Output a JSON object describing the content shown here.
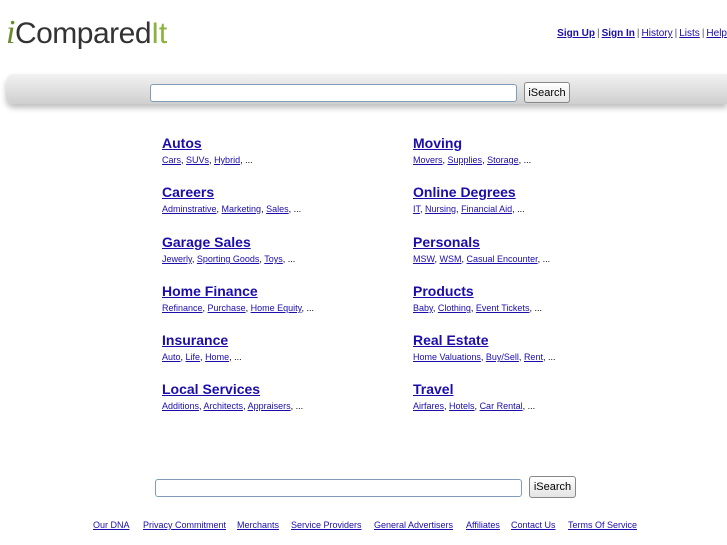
{
  "logo": {
    "i": "i",
    "compared": "Compared",
    "it": "It"
  },
  "toplinks": {
    "sign_up": "Sign Up",
    "sign_in": "Sign In",
    "history": "History",
    "lists": "Lists",
    "help": "Help",
    "sep": "|"
  },
  "search": {
    "value": "",
    "button_label": "iSearch"
  },
  "categories": [
    {
      "title": "Autos",
      "subs": [
        "Cars",
        "SUVs",
        "Hybrid"
      ]
    },
    {
      "title": "Careers",
      "subs": [
        "Adminstrative",
        "Marketing",
        "Sales"
      ]
    },
    {
      "title": "Garage Sales",
      "subs": [
        "Jewerly",
        "Sporting Goods",
        "Toys"
      ]
    },
    {
      "title": "Home Finance",
      "subs": [
        "Refinance",
        "Purchase",
        "Home Equity"
      ]
    },
    {
      "title": "Insurance",
      "subs": [
        "Auto",
        "Life",
        "Home"
      ]
    },
    {
      "title": "Local Services",
      "subs": [
        "Additions",
        "Architects",
        "Appraisers"
      ]
    },
    {
      "title": "Moving",
      "subs": [
        "Movers",
        "Supplies",
        "Storage"
      ]
    },
    {
      "title": "Online Degrees",
      "subs": [
        "IT",
        "Nursing",
        "Financial Aid"
      ]
    },
    {
      "title": "Personals",
      "subs": [
        "MSW",
        "WSM",
        "Casual Encounter"
      ]
    },
    {
      "title": "Products",
      "subs": [
        "Baby",
        "Clothing",
        "Event Tickets"
      ]
    },
    {
      "title": "Real Estate",
      "subs": [
        "Home Valuations",
        "Buy/Sell",
        "Rent"
      ]
    },
    {
      "title": "Travel",
      "subs": [
        "Airfares",
        "Hotels",
        "Car Rental"
      ]
    }
  ],
  "ellipsis": "...",
  "comma": ", ",
  "footer": [
    "Our DNA",
    "Privacy Commitment",
    "Merchants",
    "Service Providers",
    "General Advertisers",
    "Affiliates",
    "Contact Us",
    "Terms Of Service"
  ]
}
